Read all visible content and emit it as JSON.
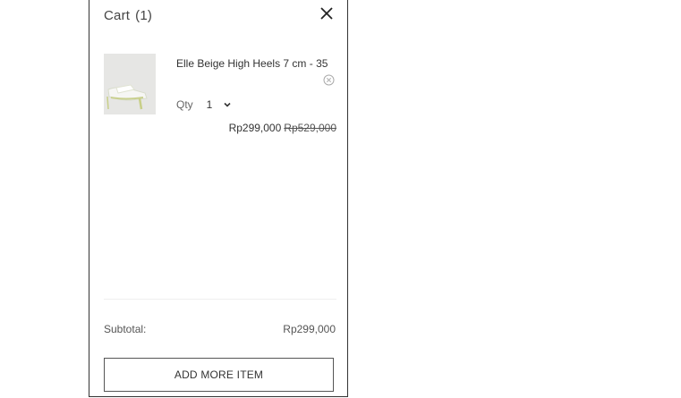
{
  "cart": {
    "title": "Cart",
    "count": "(1)",
    "close_icon": "close-icon"
  },
  "item": {
    "name": "Elle Beige High Heels 7 cm - 35",
    "qty_label": "Qty",
    "qty_value": "1",
    "price": "Rp299,000",
    "original_price": "Rp529,000",
    "remove_icon": "remove-circle-icon",
    "image_icon": "product-thumbnail"
  },
  "summary": {
    "subtotal_label": "Subtotal:",
    "subtotal_value": "Rp299,000"
  },
  "actions": {
    "add_more_label": "ADD MORE ITEM"
  },
  "colors": {
    "border": "#333333",
    "text": "#333333",
    "thumbnail_bg": "#e4e4e2"
  }
}
